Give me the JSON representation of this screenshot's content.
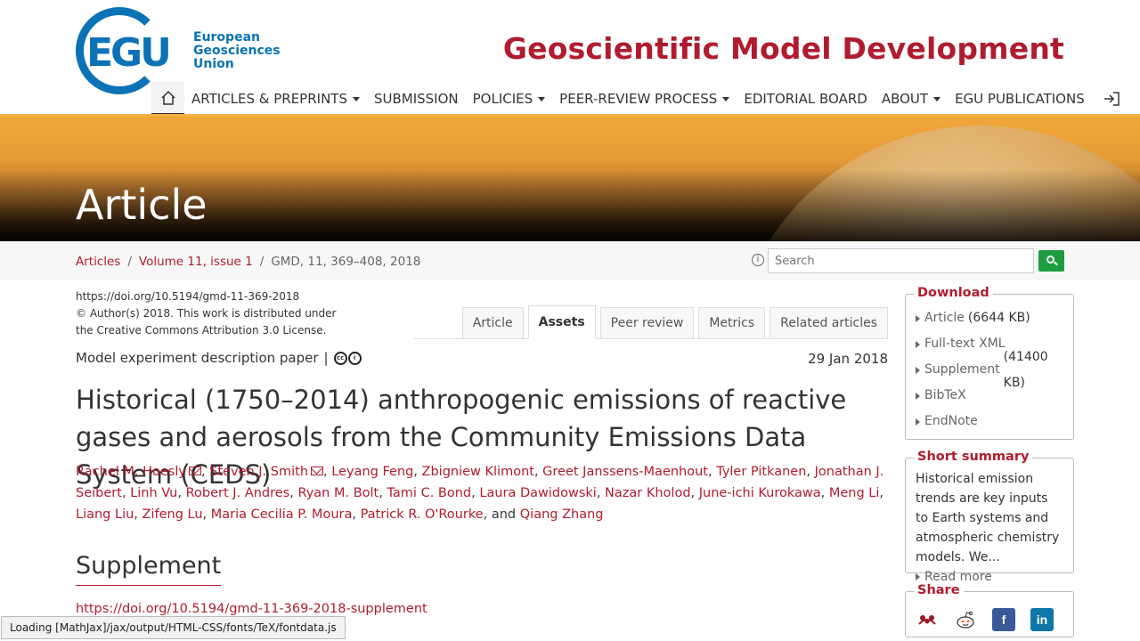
{
  "header": {
    "logo_mark": "EGU",
    "logo_words": [
      "European",
      "Geosciences",
      "Union"
    ],
    "journal_title": "Geoscientific Model Development"
  },
  "nav": {
    "home_icon": "home-icon",
    "items": [
      {
        "label": "ARTICLES & PREPRINTS",
        "dropdown": true
      },
      {
        "label": "SUBMISSION",
        "dropdown": false
      },
      {
        "label": "POLICIES",
        "dropdown": true
      },
      {
        "label": "PEER-REVIEW PROCESS",
        "dropdown": true
      },
      {
        "label": "EDITORIAL BOARD",
        "dropdown": false
      },
      {
        "label": "ABOUT",
        "dropdown": true
      },
      {
        "label": "EGU PUBLICATIONS",
        "dropdown": false
      }
    ],
    "login_icon": "login-icon"
  },
  "hero": {
    "title": "Article"
  },
  "breadcrumb": {
    "items": [
      "Articles",
      "Volume 11, issue 1"
    ],
    "current": "GMD, 11, 369–408, 2018",
    "separator": "/"
  },
  "search": {
    "placeholder": "Search"
  },
  "article": {
    "doi": "https://doi.org/10.5194/gmd-11-369-2018",
    "copyright_line1": "© Author(s) 2018. This work is distributed under",
    "copyright_line2": "the Creative Commons Attribution 3.0 License.",
    "paper_type": "Model experiment description paper",
    "paper_type_sep": "|",
    "date": "29 Jan 2018",
    "title": "Historical (1750–2014) anthropogenic emissions of reactive gases and aerosols from the Community Emissions Data System (CEDS)",
    "authors": [
      {
        "name": "Rachel M. Hoesly",
        "mail": true
      },
      {
        "name": "Steven J. Smith",
        "mail": true
      },
      {
        "name": "Leyang Feng"
      },
      {
        "name": "Zbigniew Klimont"
      },
      {
        "name": "Greet Janssens-Maenhout"
      },
      {
        "name": "Tyler Pitkanen"
      },
      {
        "name": "Jonathan J. Seibert"
      },
      {
        "name": "Linh Vu"
      },
      {
        "name": "Robert J. Andres"
      },
      {
        "name": "Ryan M. Bolt"
      },
      {
        "name": "Tami C. Bond"
      },
      {
        "name": "Laura Dawidowski"
      },
      {
        "name": "Nazar Kholod"
      },
      {
        "name": "June-ichi Kurokawa"
      },
      {
        "name": "Meng Li"
      },
      {
        "name": "Liang Liu"
      },
      {
        "name": "Zifeng Lu"
      },
      {
        "name": "Maria Cecilia P. Moura"
      },
      {
        "name": "Patrick R. O'Rourke"
      },
      {
        "name": "Qiang Zhang"
      }
    ],
    "and_word": "and"
  },
  "tabs": [
    {
      "label": "Article",
      "active": false
    },
    {
      "label": "Assets",
      "active": true
    },
    {
      "label": "Peer review",
      "active": false
    },
    {
      "label": "Metrics",
      "active": false
    },
    {
      "label": "Related articles",
      "active": false
    }
  ],
  "supplement": {
    "heading": "Supplement",
    "link": "https://doi.org/10.5194/gmd-11-369-2018-supplement"
  },
  "status_bar": "Loading [MathJax]/jax/output/HTML-CSS/fonts/TeX/fontdata.js",
  "sidebar": {
    "download": {
      "title": "Download",
      "items": [
        {
          "label": "Article",
          "size": "(6644 KB)"
        },
        {
          "label": "Full-text XML",
          "size": ""
        },
        {
          "label": "Supplement",
          "size": "(41400 KB)"
        },
        {
          "label": "BibTeX",
          "size": ""
        },
        {
          "label": "EndNote",
          "size": ""
        }
      ]
    },
    "summary": {
      "title": "Short summary",
      "text": "Historical emission trends are key inputs to Earth systems and atmospheric chemistry models. We...",
      "read_more": "Read more"
    },
    "share": {
      "title": "Share",
      "icons": [
        "mendeley-icon",
        "reddit-icon",
        "facebook-icon",
        "linkedin-icon"
      ],
      "colors": {
        "facebook": "#3b5998",
        "linkedin": "#0e76a8",
        "mendeley": "#9d1620",
        "reddit": "#ff4500"
      }
    }
  },
  "colors": {
    "accent": "#b01c2e",
    "egu_blue": "#0b72b5",
    "search_button": "#1d9d3f"
  }
}
